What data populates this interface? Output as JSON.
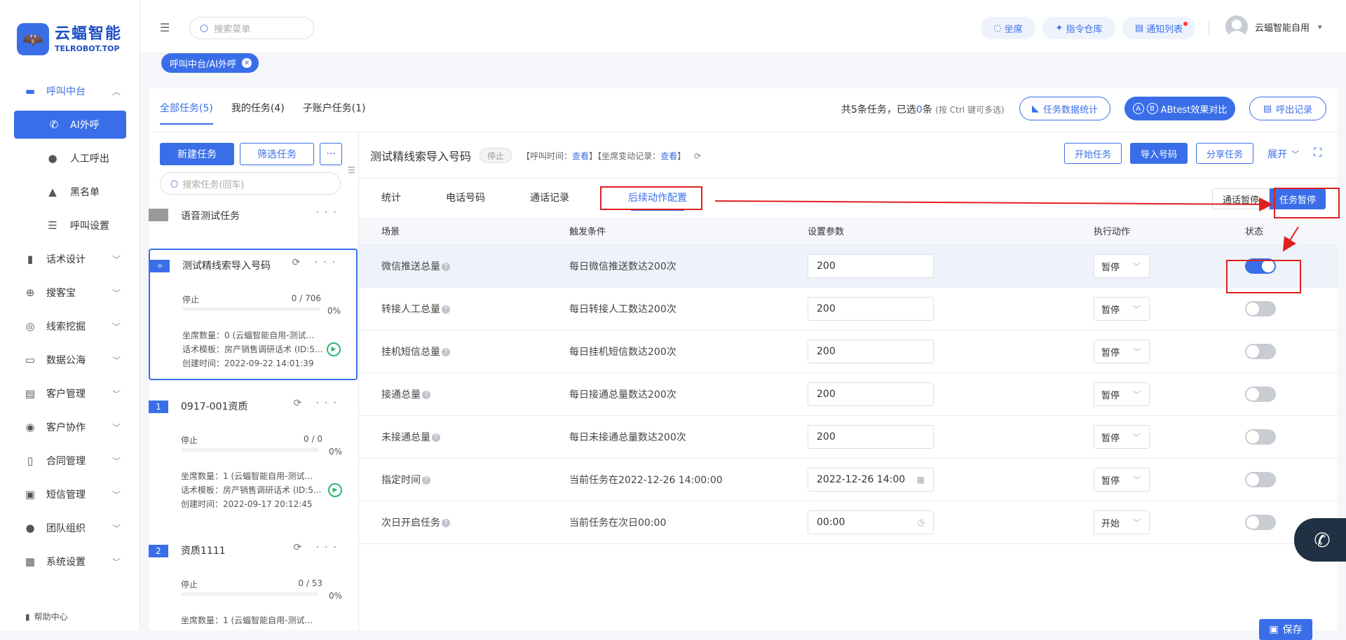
{
  "brand": {
    "name": "云蝠智能",
    "sub": "TELROBOT.TOP"
  },
  "sidebar": {
    "items": [
      {
        "label": "呼叫中台"
      },
      {
        "label": "AI外呼"
      },
      {
        "label": "人工呼出"
      },
      {
        "label": "黑名单"
      },
      {
        "label": "呼叫设置"
      },
      {
        "label": "话术设计"
      },
      {
        "label": "搜客宝"
      },
      {
        "label": "线索挖掘"
      },
      {
        "label": "数据公海"
      },
      {
        "label": "客户管理"
      },
      {
        "label": "客户协作"
      },
      {
        "label": "合同管理"
      },
      {
        "label": "短信管理"
      },
      {
        "label": "团队组织"
      },
      {
        "label": "系统设置"
      }
    ],
    "help": "帮助中心"
  },
  "header": {
    "search_placeholder": "搜索菜单",
    "btn_seat": "坐席",
    "btn_cmd": "指令仓库",
    "btn_notice": "通知列表",
    "user": "云蝠智能自用"
  },
  "breadcrumb": "呼叫中台/AI外呼",
  "main": {
    "tabs": [
      "全部任务(5)",
      "我的任务(4)",
      "子账户任务(1)"
    ],
    "summary_pre": "共5条任务，已选",
    "summary_num": "0",
    "summary_post": "条",
    "summary_hint": "(按 Ctrl 键可多选)",
    "btn_stats": "任务数据统计",
    "btn_ab": "ABtest效果对比",
    "btn_callout": "呼出记录"
  },
  "tasks": {
    "new_btn": "新建任务",
    "filter_btn": "筛选任务",
    "more_btn": "···",
    "search_placeholder": "搜索任务(回车)",
    "voice_test": "语音测试任务",
    "list": [
      {
        "badge": "",
        "title": "测试精线索导入号码",
        "status": "停止",
        "count": "0 / 706",
        "pct": "0%",
        "seats": "坐席数量：0 (云蝠智能自用-测试...",
        "template": "话术模板：房产销售调研话术 (ID:5...",
        "created": "创建时间：2022-09-22 14:01:39"
      },
      {
        "badge": "1",
        "title": "0917-001资质",
        "status": "停止",
        "count": "0 / 0",
        "pct": "0%",
        "seats": "坐席数量：1 (云蝠智能自用-测试...",
        "template": "话术模板：房产销售调研话术 (ID:5...",
        "created": "创建时间：2022-09-17 20:12:45"
      },
      {
        "badge": "2",
        "title": "资质1111",
        "status": "停止",
        "count": "0 / 53",
        "pct": "0%",
        "seats": "坐席数量：1 (云蝠智能自用-测试..."
      }
    ]
  },
  "content": {
    "title": "测试精线索导入号码",
    "status": "停止",
    "call_time_label": "【呼叫时间：",
    "view1": "查看",
    "seat_change_label": "】【坐席变动记录：",
    "view2": "查看",
    "close_bracket": "】",
    "btn_start": "开始任务",
    "btn_import": "导入号码",
    "btn_share": "分享任务",
    "btn_expand": "展开",
    "tabs": [
      "统计",
      "电话号码",
      "通话记录",
      "后续动作配置"
    ],
    "seg_call": "通话暂停",
    "seg_task": "任务暂停",
    "columns": [
      "场景",
      "触发条件",
      "设置参数",
      "执行动作",
      "状态"
    ],
    "rows": [
      {
        "scene": "微信推送总量",
        "cond": "每日微信推送数达200次",
        "param": "200",
        "action": "暂停",
        "on": true
      },
      {
        "scene": "转接人工总量",
        "cond": "每日转接人工数达200次",
        "param": "200",
        "action": "暂停",
        "on": false
      },
      {
        "scene": "挂机短信总量",
        "cond": "每日挂机短信数达200次",
        "param": "200",
        "action": "暂停",
        "on": false
      },
      {
        "scene": "接通总量",
        "cond": "每日接通总量数达200次",
        "param": "200",
        "action": "暂停",
        "on": false
      },
      {
        "scene": "未接通总量",
        "cond": "每日未接通总量数达200次",
        "param": "200",
        "action": "暂停",
        "on": false
      },
      {
        "scene": "指定时间",
        "cond": "当前任务在2022-12-26 14:00:00",
        "param": "2022-12-26 14:00",
        "action": "暂停",
        "on": false
      },
      {
        "scene": "次日开启任务",
        "cond": "当前任务在次日00:00",
        "param": "00:00",
        "action": "开始",
        "on": false
      }
    ],
    "save": "保存"
  },
  "colors": {
    "accent": "#3a6ee8",
    "annotation": "#e02020",
    "success": "#2bb673"
  }
}
